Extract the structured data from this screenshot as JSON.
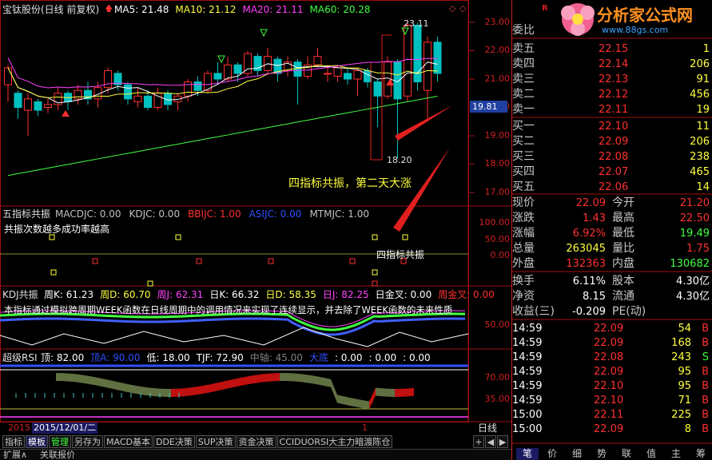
{
  "chart": {
    "title": "宝钛股份(日线 前复权)",
    "ma_labels": [
      {
        "name": "MA5: 21.48",
        "color": "#ffffff"
      },
      {
        "name": "MA10: 21.12",
        "color": "#ffff40"
      },
      {
        "name": "MA20: 21.11",
        "color": "#ff40ff"
      },
      {
        "name": "MA60: 20.28",
        "color": "#40ff40"
      }
    ],
    "price_axis": [
      "23.00",
      "22.00",
      "21.00",
      "20.00",
      "19.00",
      "18.00",
      "17.00"
    ],
    "current_price_tag": "19.81",
    "high_marker": "23.11",
    "low_marker": "18.20",
    "annotation_main": "四指标共振，第二天大涨",
    "annotation_sub": "四指标共振"
  },
  "panel2": {
    "title": "五指标共振",
    "items": [
      {
        "label": "MACDJC: 0.00",
        "color": "#c0c0c0"
      },
      {
        "label": "KDJC: 0.00",
        "color": "#c0c0c0"
      },
      {
        "label": "BBIJC: 1.00",
        "color": "#ff3030"
      },
      {
        "label": "ASIJC: 0.00",
        "color": "#3050ff"
      },
      {
        "label": "MTMJC: 1.00",
        "color": "#c0c0c0"
      }
    ],
    "note": "共振次数越多成功率越高",
    "axis": [
      "100.00",
      "50.00",
      "0.00"
    ]
  },
  "panel3": {
    "title": "KDJ共振",
    "items": [
      {
        "label": "周K: 61.23",
        "color": "#ffffff"
      },
      {
        "label": "周D: 60.70",
        "color": "#ffff40"
      },
      {
        "label": "周J: 62.31",
        "color": "#ff40ff"
      },
      {
        "label": "日K: 66.32",
        "color": "#ffffff"
      },
      {
        "label": "日D: 58.35",
        "color": "#ffff40"
      },
      {
        "label": "日J: 82.25",
        "color": "#ff40ff"
      },
      {
        "label": "日金叉: 0.00",
        "color": "#ffffff"
      },
      {
        "label": "周金叉: 0.00",
        "color": "#ff3030"
      }
    ],
    "note": "本指标通过模拟跨周期WEEK函数在日线周期中的调用情况来实现了连续显示，并去除了WEEK函数的未来性质",
    "axis": [
      "50.00"
    ]
  },
  "panel4": {
    "title": "超级RSI",
    "items": [
      {
        "label": "顶: 82.00",
        "color": "#ffffff"
      },
      {
        "label": "顶A: 90.00",
        "color": "#3050ff"
      },
      {
        "label": "低: 18.00",
        "color": "#ffffff"
      },
      {
        "label": "TJF: 72.90",
        "color": "#ffffff"
      },
      {
        "label": "中轴: 45.00",
        "color": "#808080"
      },
      {
        "label": "大底",
        "color": "#3050ff"
      },
      {
        "label": ": 0.00",
        "color": "#ffffff"
      },
      {
        "label": ": 0.00",
        "color": "#ffffff"
      },
      {
        "label": ": 0.00",
        "color": "#ffffff"
      }
    ],
    "axis": [
      "70.00",
      "35.00"
    ]
  },
  "dates": {
    "year": "2015",
    "date": "2015/12/01/二",
    "marker": "1",
    "period": "日线"
  },
  "tabs": [
    "指标",
    "模板",
    "管理",
    "另存为",
    "MACD基本",
    "DDE决策",
    "SUP决策",
    "资金决策",
    "CCIDUORSI大主力暗渡陈仓"
  ],
  "tab_controls": [
    "+",
    "◀",
    "▶"
  ],
  "status": {
    "expand": "扩展∧",
    "related": "关联报价"
  },
  "right_panel": {
    "logo_title": "分析家公式网",
    "logo_url": "www.88gs.com",
    "corner_flag": "R",
    "weibi": "委比",
    "sells": [
      {
        "label": "卖五",
        "price": "22.15",
        "vol": "1"
      },
      {
        "label": "卖四",
        "price": "22.14",
        "vol": "206"
      },
      {
        "label": "卖三",
        "price": "22.13",
        "vol": "91"
      },
      {
        "label": "卖二",
        "price": "22.12",
        "vol": "456"
      },
      {
        "label": "卖一",
        "price": "22.11",
        "vol": "19"
      }
    ],
    "buys": [
      {
        "label": "买一",
        "price": "22.10",
        "vol": "11"
      },
      {
        "label": "买二",
        "price": "22.09",
        "vol": "206"
      },
      {
        "label": "买三",
        "price": "22.08",
        "vol": "238"
      },
      {
        "label": "买四",
        "price": "22.07",
        "vol": "465"
      },
      {
        "label": "买五",
        "price": "22.06",
        "vol": "14"
      }
    ],
    "quote": [
      {
        "l1": "现价",
        "v1": "22.09",
        "c1": "#ff3030",
        "l2": "今开",
        "v2": "21.20",
        "c2": "#ff3030"
      },
      {
        "l1": "涨跌",
        "v1": "1.43",
        "c1": "#ff3030",
        "l2": "最高",
        "v2": "22.50",
        "c2": "#ff3030"
      },
      {
        "l1": "涨幅",
        "v1": "6.92%",
        "c1": "#ff3030",
        "l2": "最低",
        "v2": "19.49",
        "c2": "#40ff40"
      },
      {
        "l1": "总量",
        "v1": "263045",
        "c1": "#ffff40",
        "l2": "量比",
        "v2": "1.75",
        "c2": "#ff3030"
      },
      {
        "l1": "外盘",
        "v1": "132363",
        "c1": "#ff3030",
        "l2": "内盘",
        "v2": "130682",
        "c2": "#40ff40"
      }
    ],
    "stats": [
      {
        "l1": "换手",
        "v1": "6.11%",
        "l2": "股本",
        "v2": "4.30亿"
      },
      {
        "l1": "净资",
        "v1": "8.15",
        "l2": "流通",
        "v2": "4.30亿"
      },
      {
        "l1": "收益(三)",
        "v1": "-0.209",
        "l2": "PE(动)",
        "v2": ""
      }
    ],
    "ticks": [
      {
        "time": "14:59",
        "price": "22.09",
        "vol": "54",
        "side": "B"
      },
      {
        "time": "14:59",
        "price": "22.09",
        "vol": "168",
        "side": "B"
      },
      {
        "time": "14:59",
        "price": "22.08",
        "vol": "243",
        "side": "S"
      },
      {
        "time": "14:59",
        "price": "22.09",
        "vol": "95",
        "side": "B"
      },
      {
        "time": "14:59",
        "price": "22.10",
        "vol": "95",
        "side": "B"
      },
      {
        "time": "14:59",
        "price": "22.10",
        "vol": "71",
        "side": "B"
      },
      {
        "time": "15:00",
        "price": "22.11",
        "vol": "225",
        "side": "B"
      },
      {
        "time": "15:00",
        "price": "22.09",
        "vol": "8",
        "side": "B"
      }
    ],
    "bottom_tabs": [
      "笔",
      "价",
      "细",
      "势",
      "联",
      "值",
      "主",
      "筹"
    ]
  }
}
